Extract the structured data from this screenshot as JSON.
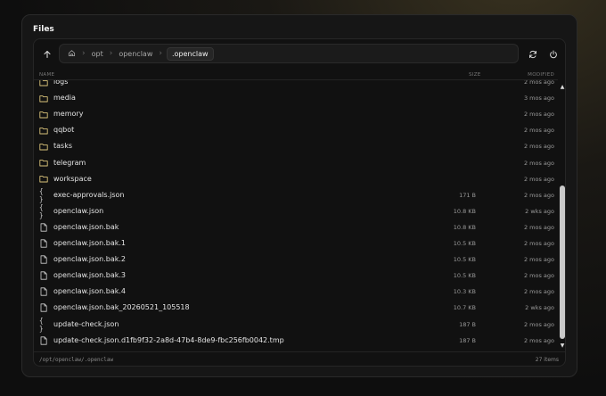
{
  "panel": {
    "title": "Files"
  },
  "toolbar": {
    "breadcrumb": [
      "opt",
      "openclaw",
      ".openclaw"
    ]
  },
  "columns": {
    "name": "NAME",
    "size": "SIZE",
    "modified": "MODIFIED"
  },
  "rows": [
    {
      "type": "folder",
      "name": "logs",
      "size": "",
      "modified": "2 mos ago"
    },
    {
      "type": "folder",
      "name": "media",
      "size": "",
      "modified": "3 mos ago"
    },
    {
      "type": "folder",
      "name": "memory",
      "size": "",
      "modified": "2 mos ago"
    },
    {
      "type": "folder",
      "name": "qqbot",
      "size": "",
      "modified": "2 mos ago"
    },
    {
      "type": "folder",
      "name": "tasks",
      "size": "",
      "modified": "2 mos ago"
    },
    {
      "type": "folder",
      "name": "telegram",
      "size": "",
      "modified": "2 mos ago"
    },
    {
      "type": "folder",
      "name": "workspace",
      "size": "",
      "modified": "2 mos ago"
    },
    {
      "type": "json",
      "name": "exec-approvals.json",
      "size": "171 B",
      "modified": "2 mos ago"
    },
    {
      "type": "json",
      "name": "openclaw.json",
      "size": "10.8 KB",
      "modified": "2 wks ago"
    },
    {
      "type": "file",
      "name": "openclaw.json.bak",
      "size": "10.8 KB",
      "modified": "2 mos ago"
    },
    {
      "type": "file",
      "name": "openclaw.json.bak.1",
      "size": "10.5 KB",
      "modified": "2 mos ago"
    },
    {
      "type": "file",
      "name": "openclaw.json.bak.2",
      "size": "10.5 KB",
      "modified": "2 mos ago"
    },
    {
      "type": "file",
      "name": "openclaw.json.bak.3",
      "size": "10.5 KB",
      "modified": "2 mos ago"
    },
    {
      "type": "file",
      "name": "openclaw.json.bak.4",
      "size": "10.3 KB",
      "modified": "2 mos ago"
    },
    {
      "type": "file",
      "name": "openclaw.json.bak_20260521_105518",
      "size": "10.7 KB",
      "modified": "2 wks ago"
    },
    {
      "type": "json",
      "name": "update-check.json",
      "size": "187 B",
      "modified": "2 mos ago"
    },
    {
      "type": "file",
      "name": "update-check.json.d1fb9f32-2a8d-47b4-8de9-fbc256fb0042.tmp",
      "size": "187 B",
      "modified": "2 mos ago"
    }
  ],
  "footer": {
    "path": "/opt/openclaw/.openclaw",
    "count": "27 items"
  },
  "icons": {
    "up": "arrow-up-icon",
    "home": "home-icon",
    "refresh": "refresh-icon",
    "power": "power-icon",
    "folder": "folder-icon",
    "json": "json-file-icon",
    "file": "file-icon"
  },
  "colors": {
    "background": "#0e0e0e",
    "panel": "#161616",
    "text": "#e6e6e6",
    "muted": "#9a9a9a",
    "folder_icon": "#d9c27a"
  }
}
